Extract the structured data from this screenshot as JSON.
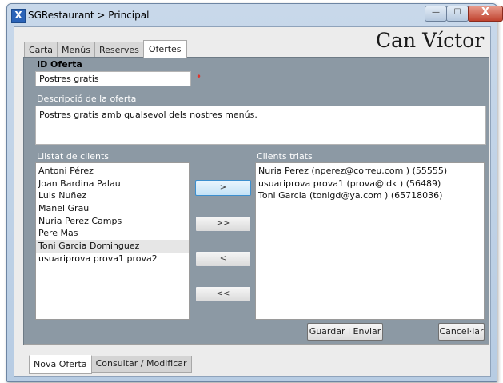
{
  "window": {
    "title": "SGRestaurant > Principal",
    "app_icon": "X",
    "controls": {
      "minimize": "—",
      "maximize": "☐",
      "close": "X"
    }
  },
  "brand": "Can Víctor",
  "tabs_top": [
    "Carta",
    "Menús",
    "Reserves",
    "Ofertes"
  ],
  "form": {
    "id_label": "ID Oferta",
    "id_value": "Postres gratis",
    "required_mark": "•",
    "desc_label": "Descripció de la oferta",
    "desc_value": "Postres gratis amb qualsevol dels nostres menús.",
    "clients_label": "Llistat de clients",
    "clients": [
      "Antoni Pérez",
      "Joan Bardina Palau",
      "Luis Nuñez",
      "Manel Grau",
      "Nuria Perez Camps",
      "Pere Mas",
      "Toni Garcia Dominguez",
      "usuariprova prova1 prova2"
    ],
    "selected_label": "Clients triats",
    "selected": [
      "Nuria Perez (nperez@correu.com ) (55555)",
      "usuariprova prova1 (prova@ldk ) (56489)",
      "Toni Garcia (tonigd@ya.com ) (65718036)"
    ],
    "move_buttons": [
      ">",
      ">>",
      "<",
      "<<"
    ],
    "save_label": "Guardar i Enviar",
    "cancel_label": "Cancel·lar"
  },
  "tabs_bottom": [
    "Nova Oferta",
    "Consultar / Modificar"
  ]
}
